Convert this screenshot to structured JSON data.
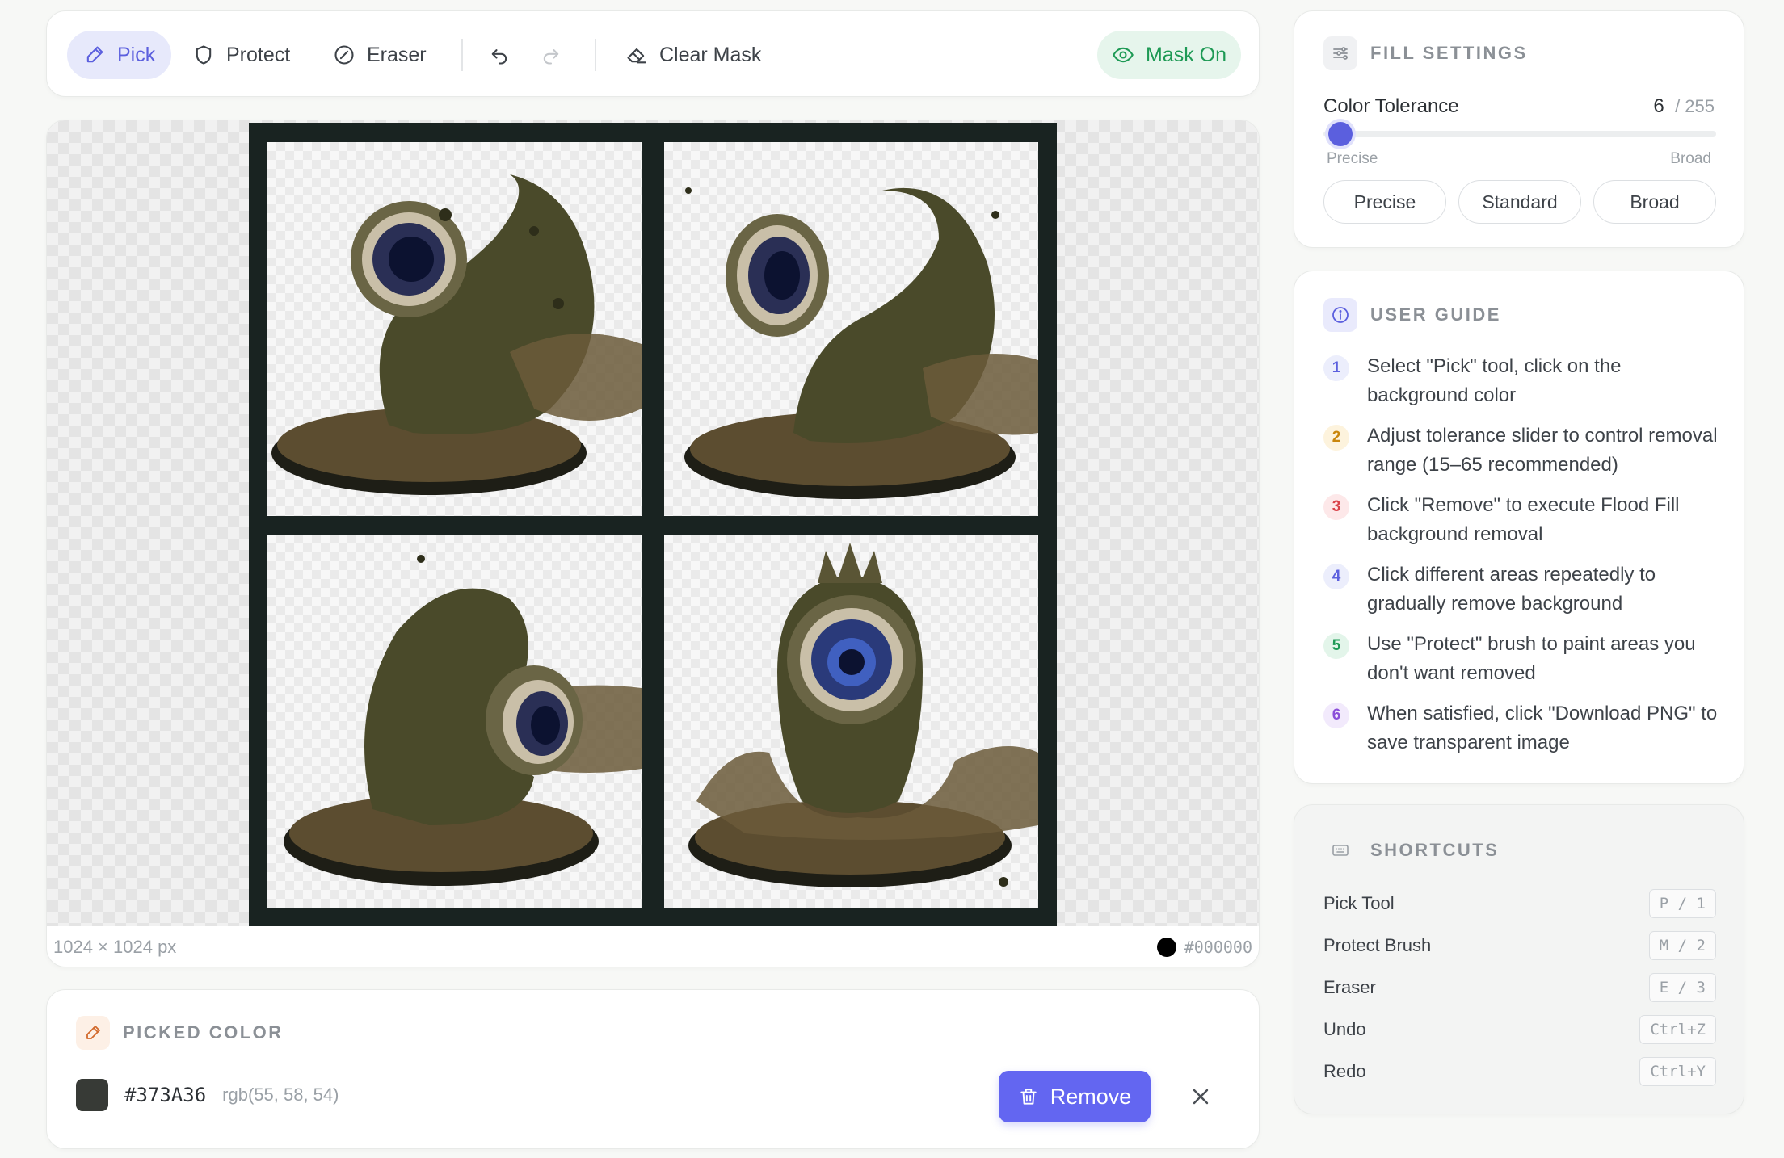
{
  "toolbar": {
    "pick": "Pick",
    "protect": "Protect",
    "eraser": "Eraser",
    "clear_mask": "Clear Mask",
    "mask_toggle": "Mask On"
  },
  "canvas": {
    "dimensions": "1024 × 1024 px",
    "bg_color_hex": "#000000"
  },
  "picked": {
    "title": "PICKED COLOR",
    "hex": "#373A36",
    "rgb": "rgb(55, 58, 54)",
    "remove_label": "Remove"
  },
  "fill": {
    "title": "FILL SETTINGS",
    "tolerance_label": "Color Tolerance",
    "tolerance_value": "6",
    "tolerance_max": "/ 255",
    "tolerance_fraction": 0.0235,
    "min_label": "Precise",
    "max_label": "Broad",
    "presets": [
      "Precise",
      "Standard",
      "Broad"
    ]
  },
  "guide": {
    "title": "USER GUIDE",
    "steps": [
      {
        "num": "1",
        "text": "Select \"Pick\" tool, click on the background color"
      },
      {
        "num": "2",
        "text": "Adjust tolerance slider to control removal range (15–65 recommended)"
      },
      {
        "num": "3",
        "text": "Click \"Remove\" to execute Flood Fill background removal"
      },
      {
        "num": "4",
        "text": "Click different areas repeatedly to gradually remove background"
      },
      {
        "num": "5",
        "text": "Use \"Protect\" brush to paint areas you don't want removed"
      },
      {
        "num": "6",
        "text": "When satisfied, click \"Download PNG\" to save transparent image"
      }
    ]
  },
  "shortcuts": {
    "title": "SHORTCUTS",
    "items": [
      {
        "label": "Pick Tool",
        "key": "P / 1"
      },
      {
        "label": "Protect Brush",
        "key": "M / 2"
      },
      {
        "label": "Eraser",
        "key": "E / 3"
      },
      {
        "label": "Undo",
        "key": "Ctrl+Z"
      },
      {
        "label": "Redo",
        "key": "Ctrl+Y"
      }
    ]
  },
  "colors": {
    "accent": "#6366f1",
    "mask_green": "#1e9a55",
    "picked_swatch": "#373A36",
    "step_colors": [
      "#5b5fde",
      "#c9860c",
      "#d9434a",
      "#5b5fde",
      "#1e9a55",
      "#8b4fd9"
    ]
  }
}
